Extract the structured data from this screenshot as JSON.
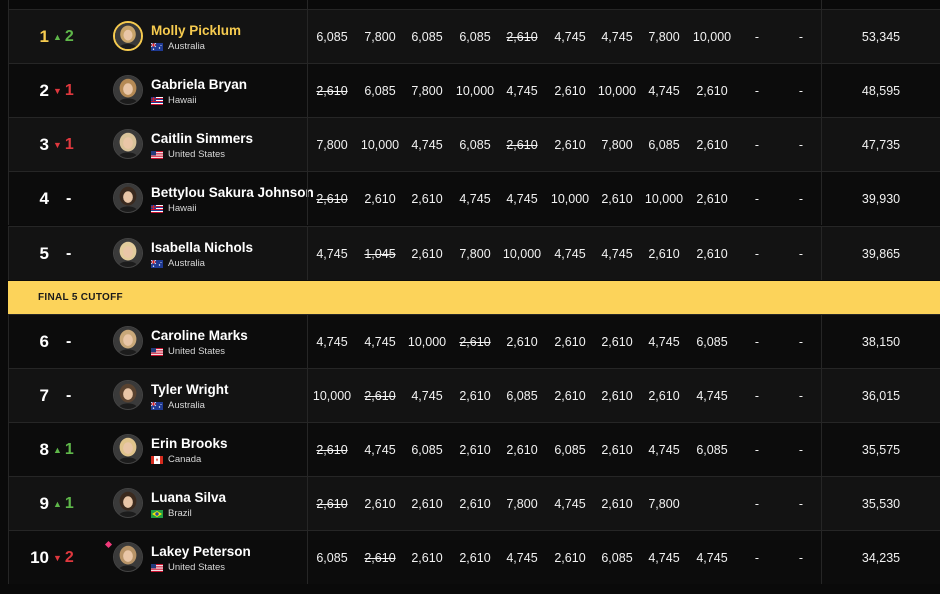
{
  "cutoff_label": "FINAL 5 CUTOFF",
  "colors": {
    "gold": "#f6cb4f",
    "up": "#5fb84a",
    "down": "#e0383e",
    "cutoff_bg": "#fcd35a"
  },
  "rows": [
    {
      "rank": "1",
      "move": "up",
      "change": "2",
      "name": "Molly Picklum",
      "country": "Australia",
      "flag": "australia-flag-icon",
      "scores": [
        {
          "v": "6,085",
          "d": false
        },
        {
          "v": "7,800",
          "d": false
        },
        {
          "v": "6,085",
          "d": false
        },
        {
          "v": "6,085",
          "d": false
        },
        {
          "v": "2,610",
          "d": true
        },
        {
          "v": "4,745",
          "d": false
        },
        {
          "v": "4,745",
          "d": false
        },
        {
          "v": "7,800",
          "d": false
        },
        {
          "v": "10,000",
          "d": false
        }
      ],
      "e10": "-",
      "e11": "-",
      "total": "53,345"
    },
    {
      "rank": "2",
      "move": "down",
      "change": "1",
      "name": "Gabriela Bryan",
      "country": "Hawaii",
      "flag": "hawaii-flag-icon",
      "scores": [
        {
          "v": "2,610",
          "d": true
        },
        {
          "v": "6,085",
          "d": false
        },
        {
          "v": "7,800",
          "d": false
        },
        {
          "v": "10,000",
          "d": false
        },
        {
          "v": "4,745",
          "d": false
        },
        {
          "v": "2,610",
          "d": false
        },
        {
          "v": "10,000",
          "d": false
        },
        {
          "v": "4,745",
          "d": false
        },
        {
          "v": "2,610",
          "d": false
        }
      ],
      "e10": "-",
      "e11": "-",
      "total": "48,595"
    },
    {
      "rank": "3",
      "move": "down",
      "change": "1",
      "name": "Caitlin Simmers",
      "country": "United States",
      "flag": "usa-flag-icon",
      "scores": [
        {
          "v": "7,800",
          "d": false
        },
        {
          "v": "10,000",
          "d": false
        },
        {
          "v": "4,745",
          "d": false
        },
        {
          "v": "6,085",
          "d": false
        },
        {
          "v": "2,610",
          "d": true
        },
        {
          "v": "2,610",
          "d": false
        },
        {
          "v": "7,800",
          "d": false
        },
        {
          "v": "6,085",
          "d": false
        },
        {
          "v": "2,610",
          "d": false
        }
      ],
      "e10": "-",
      "e11": "-",
      "total": "47,735"
    },
    {
      "rank": "4",
      "move": "none",
      "change": "-",
      "name": "Bettylou Sakura Johnson",
      "country": "Hawaii",
      "flag": "hawaii-flag-icon",
      "scores": [
        {
          "v": "2,610",
          "d": true
        },
        {
          "v": "2,610",
          "d": false
        },
        {
          "v": "2,610",
          "d": false
        },
        {
          "v": "4,745",
          "d": false
        },
        {
          "v": "4,745",
          "d": false
        },
        {
          "v": "10,000",
          "d": false
        },
        {
          "v": "2,610",
          "d": false
        },
        {
          "v": "10,000",
          "d": false
        },
        {
          "v": "2,610",
          "d": false
        }
      ],
      "e10": "-",
      "e11": "-",
      "total": "39,930"
    },
    {
      "rank": "5",
      "move": "none",
      "change": "-",
      "name": "Isabella Nichols",
      "country": "Australia",
      "flag": "australia-flag-icon",
      "scores": [
        {
          "v": "4,745",
          "d": false
        },
        {
          "v": "1,045",
          "d": true
        },
        {
          "v": "2,610",
          "d": false
        },
        {
          "v": "7,800",
          "d": false
        },
        {
          "v": "10,000",
          "d": false
        },
        {
          "v": "4,745",
          "d": false
        },
        {
          "v": "4,745",
          "d": false
        },
        {
          "v": "2,610",
          "d": false
        },
        {
          "v": "2,610",
          "d": false
        }
      ],
      "e10": "-",
      "e11": "-",
      "total": "39,865"
    },
    {
      "rank": "6",
      "move": "none",
      "change": "-",
      "name": "Caroline Marks",
      "country": "United States",
      "flag": "usa-flag-icon",
      "scores": [
        {
          "v": "4,745",
          "d": false
        },
        {
          "v": "4,745",
          "d": false
        },
        {
          "v": "10,000",
          "d": false
        },
        {
          "v": "2,610",
          "d": true
        },
        {
          "v": "2,610",
          "d": false
        },
        {
          "v": "2,610",
          "d": false
        },
        {
          "v": "2,610",
          "d": false
        },
        {
          "v": "4,745",
          "d": false
        },
        {
          "v": "6,085",
          "d": false
        }
      ],
      "e10": "-",
      "e11": "-",
      "total": "38,150"
    },
    {
      "rank": "7",
      "move": "none",
      "change": "-",
      "name": "Tyler Wright",
      "country": "Australia",
      "flag": "australia-flag-icon",
      "scores": [
        {
          "v": "10,000",
          "d": false
        },
        {
          "v": "2,610",
          "d": true
        },
        {
          "v": "4,745",
          "d": false
        },
        {
          "v": "2,610",
          "d": false
        },
        {
          "v": "6,085",
          "d": false
        },
        {
          "v": "2,610",
          "d": false
        },
        {
          "v": "2,610",
          "d": false
        },
        {
          "v": "2,610",
          "d": false
        },
        {
          "v": "4,745",
          "d": false
        }
      ],
      "e10": "-",
      "e11": "-",
      "total": "36,015"
    },
    {
      "rank": "8",
      "move": "up",
      "change": "1",
      "name": "Erin Brooks",
      "country": "Canada",
      "flag": "canada-flag-icon",
      "scores": [
        {
          "v": "2,610",
          "d": true
        },
        {
          "v": "4,745",
          "d": false
        },
        {
          "v": "6,085",
          "d": false
        },
        {
          "v": "2,610",
          "d": false
        },
        {
          "v": "2,610",
          "d": false
        },
        {
          "v": "6,085",
          "d": false
        },
        {
          "v": "2,610",
          "d": false
        },
        {
          "v": "4,745",
          "d": false
        },
        {
          "v": "6,085",
          "d": false
        }
      ],
      "e10": "-",
      "e11": "-",
      "total": "35,575"
    },
    {
      "rank": "9",
      "move": "up",
      "change": "1",
      "name": "Luana Silva",
      "country": "Brazil",
      "flag": "brazil-flag-icon",
      "scores": [
        {
          "v": "2,610",
          "d": true
        },
        {
          "v": "2,610",
          "d": false
        },
        {
          "v": "2,610",
          "d": false
        },
        {
          "v": "2,610",
          "d": false
        },
        {
          "v": "7,800",
          "d": false
        },
        {
          "v": "4,745",
          "d": false
        },
        {
          "v": "2,610",
          "d": false
        },
        {
          "v": "7,800",
          "d": false
        },
        {
          "v": "",
          "d": false
        }
      ],
      "e10": "-",
      "e11": "-",
      "total": "35,530"
    },
    {
      "rank": "10",
      "move": "down",
      "change": "2",
      "name": "Lakey Peterson",
      "country": "United States",
      "flag": "usa-flag-icon",
      "marker": true,
      "scores": [
        {
          "v": "6,085",
          "d": false
        },
        {
          "v": "2,610",
          "d": true
        },
        {
          "v": "2,610",
          "d": false
        },
        {
          "v": "2,610",
          "d": false
        },
        {
          "v": "4,745",
          "d": false
        },
        {
          "v": "2,610",
          "d": false
        },
        {
          "v": "6,085",
          "d": false
        },
        {
          "v": "4,745",
          "d": false
        },
        {
          "v": "4,745",
          "d": false
        }
      ],
      "e10": "-",
      "e11": "-",
      "total": "34,235"
    }
  ]
}
